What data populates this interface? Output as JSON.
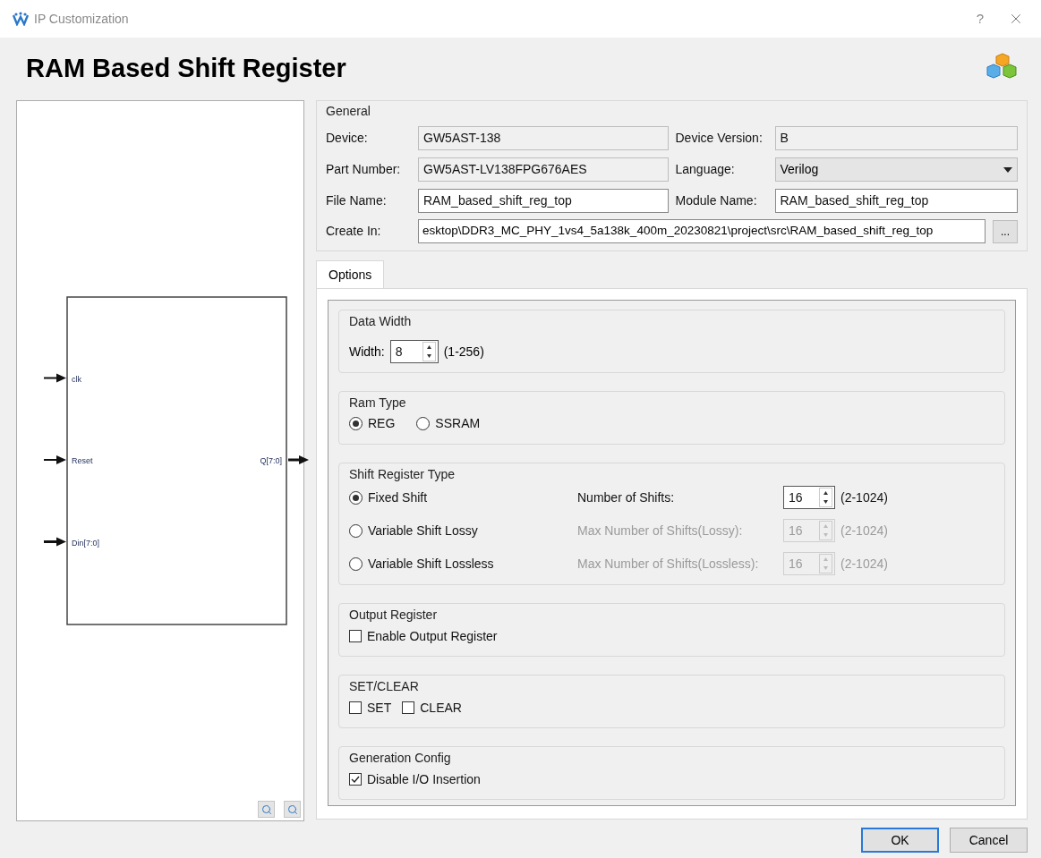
{
  "window": {
    "title": "IP Customization",
    "help": "?"
  },
  "header": {
    "title": "RAM Based Shift Register"
  },
  "diagram": {
    "inputs": [
      {
        "name": "clk",
        "bus": false
      },
      {
        "name": "Reset",
        "bus": false
      },
      {
        "name": "Din[7:0]",
        "bus": true
      }
    ],
    "outputs": [
      {
        "name": "Q[7:0]",
        "bus": true
      }
    ]
  },
  "general": {
    "title": "General",
    "fields": [
      {
        "label": "Device:",
        "value": "GW5AST-138",
        "kind": "readonly"
      },
      {
        "label": "Device Version:",
        "value": "B",
        "kind": "readonly"
      },
      {
        "label": "Part Number:",
        "value": "GW5AST-LV138FPG676AES",
        "kind": "readonly"
      },
      {
        "label": "Language:",
        "value": "Verilog",
        "kind": "select"
      },
      {
        "label": "File Name:",
        "value": "RAM_based_shift_reg_top",
        "kind": "text"
      },
      {
        "label": "Module Name:",
        "value": "RAM_based_shift_reg_top",
        "kind": "text"
      }
    ],
    "create_in": {
      "label": "Create In:",
      "value": "esktop\\DDR3_MC_PHY_1vs4_5a138k_400m_20230821\\project\\src\\RAM_based_shift_reg_top",
      "browse": "..."
    }
  },
  "tabs": [
    {
      "label": "Options",
      "selected": true
    }
  ],
  "data_width": {
    "title": "Data Width",
    "label": "Width:",
    "value": "8",
    "range": "(1-256)"
  },
  "ram_type": {
    "title": "Ram Type",
    "options": [
      {
        "label": "REG",
        "selected": true
      },
      {
        "label": "SSRAM",
        "selected": false
      }
    ]
  },
  "shift_register_type": {
    "title": "Shift Register Type",
    "rows": [
      {
        "label": "Fixed Shift",
        "selected": true,
        "param_label": "Number of Shifts:",
        "value": "16",
        "range": "(2-1024)",
        "disabled": false
      },
      {
        "label": "Variable Shift Lossy",
        "selected": false,
        "param_label": "Max Number of Shifts(Lossy):",
        "value": "16",
        "range": "(2-1024)",
        "disabled": true
      },
      {
        "label": "Variable Shift Lossless",
        "selected": false,
        "param_label": "Max Number of Shifts(Lossless):",
        "value": "16",
        "range": "(2-1024)",
        "disabled": true
      }
    ]
  },
  "output_register": {
    "title": "Output Register",
    "checks": [
      {
        "label": "Enable Output Register",
        "checked": false
      }
    ]
  },
  "set_clear": {
    "title": "SET/CLEAR",
    "checks": [
      {
        "label": "SET",
        "checked": false
      },
      {
        "label": "CLEAR",
        "checked": false
      }
    ]
  },
  "generation_config": {
    "title": "Generation Config",
    "checks": [
      {
        "label": "Disable I/O Insertion",
        "checked": true
      }
    ]
  },
  "buttons": [
    {
      "label": "OK",
      "default": true
    },
    {
      "label": "Cancel",
      "default": false
    }
  ]
}
